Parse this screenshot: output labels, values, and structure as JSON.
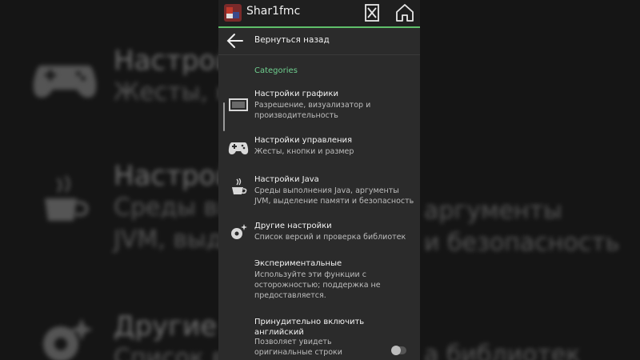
{
  "app": {
    "title": "Shar1fmc"
  },
  "back": {
    "label": "Вернуться назад"
  },
  "section": {
    "categories": "Categories"
  },
  "items": [
    {
      "title": "Настройки графики",
      "desc": "Разрешение, визуализатор и производительность",
      "icon": "display-icon"
    },
    {
      "title": "Настройки управления",
      "desc": "Жесты, кнопки и размер",
      "icon": "gamepad-icon"
    },
    {
      "title": "Настройки Java",
      "desc": "Среды выполнения Java, аргументы JVM, выделение памяти и безопасность",
      "icon": "java-cup-icon"
    },
    {
      "title": "Другие настройки",
      "desc": "Список версий и проверка библиотек",
      "icon": "gear-sparkle-icon"
    },
    {
      "title": "Экспериментальные",
      "desc": "Используйте эти функции с осторожностью; поддержка не предоставляется.",
      "icon": "none"
    },
    {
      "title": "Принудительно включить английский",
      "desc": "Позволяет увидеть оригинальные строки",
      "icon": "none"
    }
  ],
  "background": {
    "title1": "Настройки",
    "sub1": "Жесты, к",
    "title2": "Настройки",
    "sub2a": "Среды вы",
    "sub2b": "JVM, выд",
    "right2a": "аргументы",
    "right2b": "и безопасность",
    "title3": "Другие н",
    "sub3": "Список в",
    "right3": "а библиотек"
  },
  "colors": {
    "accent": "#5fbf6a",
    "categories": "#6fcf8f",
    "panel": "#2b2b2b",
    "topbar": "#1f1f1f"
  }
}
